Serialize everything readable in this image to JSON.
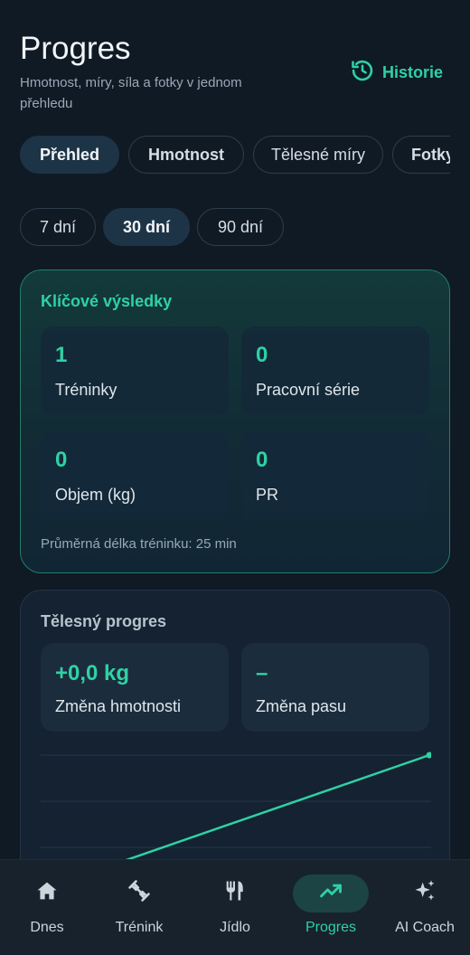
{
  "header": {
    "title": "Progres",
    "subtitle": "Hmotnost, míry, síla a fotky v jednom přehledu",
    "history_label": "Historie"
  },
  "tabs": [
    {
      "label": "Přehled",
      "active": true
    },
    {
      "label": "Hmotnost",
      "active": false
    },
    {
      "label": "Tělesné míry",
      "active": false
    },
    {
      "label": "Fotky",
      "active": false
    }
  ],
  "ranges": [
    {
      "label": "7 dní",
      "active": false
    },
    {
      "label": "30 dní",
      "active": true
    },
    {
      "label": "90 dní",
      "active": false
    }
  ],
  "key_results": {
    "title": "Klíčové výsledky",
    "stats": [
      {
        "value": "1",
        "label": "Tréninky"
      },
      {
        "value": "0",
        "label": "Pracovní série"
      },
      {
        "value": "0",
        "label": "Objem (kg)"
      },
      {
        "value": "0",
        "label": "PR"
      }
    ],
    "average_text": "Průměrná délka tréninku: 25 min"
  },
  "body_progress": {
    "title": "Tělesný progres",
    "stats": [
      {
        "value": "+0,0 kg",
        "label": "Změna hmotnosti"
      },
      {
        "value": "–",
        "label": "Změna pasu"
      }
    ]
  },
  "bottom_nav": [
    {
      "label": "Dnes",
      "icon": "home-icon",
      "active": false
    },
    {
      "label": "Trénink",
      "icon": "dumbbell-icon",
      "active": false
    },
    {
      "label": "Jídlo",
      "icon": "fork-knife-icon",
      "active": false
    },
    {
      "label": "Progres",
      "icon": "trend-icon",
      "active": true
    },
    {
      "label": "AI Coach",
      "icon": "sparkles-icon",
      "active": false
    }
  ],
  "colors": {
    "accent": "#2fd1a5",
    "background": "#0f1a25",
    "card": "#142231"
  }
}
